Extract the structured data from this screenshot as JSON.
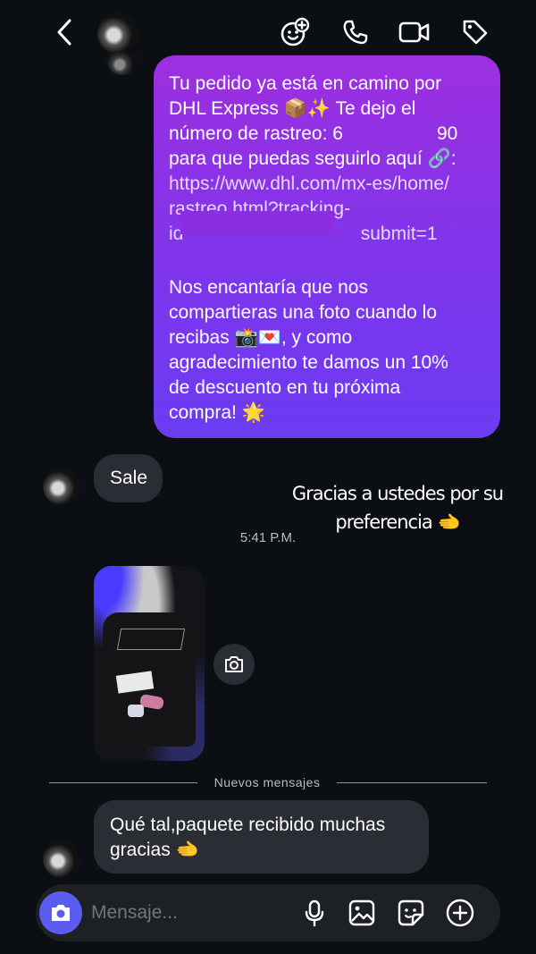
{
  "header": {
    "back_icon": "chevron-left-icon",
    "actions": [
      "emoji-add-icon",
      "phone-icon",
      "video-icon",
      "tag-icon"
    ]
  },
  "outgoing_message": {
    "paragraph1_lines": [
      "Tu pedido ya está en camino por",
      "DHL Express 📦✨  Te dejo el",
      "número de rastreo: 6                  90",
      "para que puedas seguirlo aquí 🔗:",
      "https://www.dhl.com/mx-es/home/",
      "rastreo.html?tracking-",
      "id                                  submit=1"
    ],
    "paragraph2_lines": [
      "Nos encantaría que nos",
      "compartieras una foto cuando lo",
      "recibas 📸💌, y como",
      "agradecimiento te damos un 10%",
      "de descuento en tu próxima",
      "compra! 🌟"
    ]
  },
  "incoming_reply": {
    "text": "Sale"
  },
  "story_caption": {
    "line1": "Gracias a ustedes por su",
    "line2": "preferencia 🫲"
  },
  "timestamp": "5:41 P.M.",
  "divider_label": "Nuevos mensajes",
  "last_message": {
    "line1": "Qué tal,paquete recibido muchas",
    "line2": "gracias 🫲"
  },
  "composer": {
    "placeholder": "Mensaje...",
    "actions": [
      "microphone-icon",
      "gallery-icon",
      "sticker-icon",
      "plus-icon"
    ]
  },
  "colors": {
    "background": "#0b0f13",
    "bubble_gray": "#2a2d33",
    "bubble_purple_top": "#9d2fe0",
    "bubble_purple_bottom": "#6a3cf2",
    "camera_button": "#5b5cf0"
  }
}
